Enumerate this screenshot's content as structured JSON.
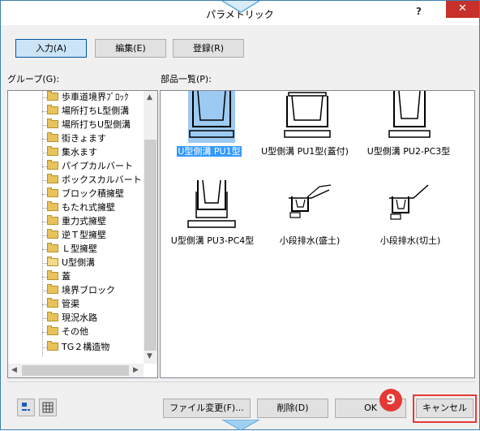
{
  "window": {
    "title": "パラメトリック",
    "help_label": "?",
    "close_label": "✕"
  },
  "tabs": {
    "input": "入力(A)",
    "edit": "編集(E)",
    "register": "登録(R)"
  },
  "group": {
    "label": "グループ(G):",
    "items": [
      "歩車道境界ﾌﾞﾛｯｸ",
      "場所打ちL型側溝",
      "場所打ちU型側溝",
      "街きょます",
      "集水ます",
      "パイプカルバート",
      "ボックスカルバート",
      "ブロック積擁壁",
      "もたれ式擁壁",
      "重力式擁壁",
      "逆Ｔ型擁壁",
      "Ｌ型擁壁",
      "U型側溝",
      "蓋",
      "境界ブロック",
      "管渠",
      "現況水路",
      "その他",
      "TG２構造物"
    ]
  },
  "parts": {
    "label": "部品一覧(P):",
    "items": [
      "U型側溝 PU1型",
      "U型側溝 PU1型(蓋付)",
      "U型側溝 PU2-PC3型",
      "U型側溝 PU3-PC4型",
      "小段排水(盛土)",
      "小段排水(切土)"
    ]
  },
  "footer": {
    "change_file": "ファイル変更(F)...",
    "delete": "削除(D)",
    "ok": "OK",
    "cancel": "キャンセル",
    "step_badge": "9"
  }
}
